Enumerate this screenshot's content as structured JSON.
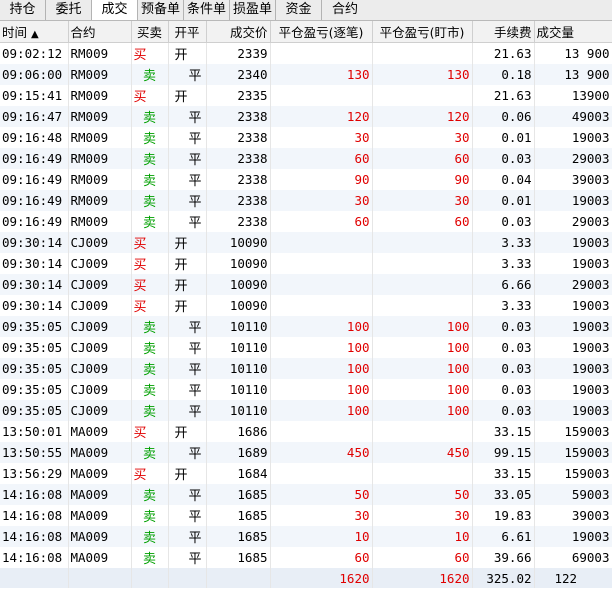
{
  "tabs": [
    {
      "label": "持仓",
      "active": false
    },
    {
      "label": "委托",
      "active": false
    },
    {
      "label": "成交",
      "active": true
    },
    {
      "label": "预备单",
      "active": false
    },
    {
      "label": "条件单",
      "active": false
    },
    {
      "label": "损盈单",
      "active": false
    },
    {
      "label": "资金",
      "active": false
    },
    {
      "label": "合约",
      "active": false
    }
  ],
  "columns": {
    "time": "时间",
    "sort_arrow": "▲",
    "code": "合约",
    "side": "买卖",
    "oc": "开平",
    "price": "成交价",
    "pnl_trade": "平仓盈亏(逐笔)",
    "pnl_mark": "平仓盈亏(盯市)",
    "fee": "手续费",
    "volume": "成交量"
  },
  "rows": [
    {
      "time": "09:02:12",
      "code": "RM009",
      "side": "买",
      "oc": "开",
      "price": "2339",
      "p1": "",
      "p2": "",
      "fee": "21.63",
      "vol": "13 900"
    },
    {
      "time": "09:06:00",
      "code": "RM009",
      "side": "卖",
      "oc": "平",
      "price": "2340",
      "p1": "130",
      "p2": "130",
      "fee": "0.18",
      "vol": "13 900"
    },
    {
      "time": "09:15:41",
      "code": "RM009",
      "side": "买",
      "oc": "开",
      "price": "2335",
      "p1": "",
      "p2": "",
      "fee": "21.63",
      "vol": "13900"
    },
    {
      "time": "09:16:47",
      "code": "RM009",
      "side": "卖",
      "oc": "平",
      "price": "2338",
      "p1": "120",
      "p2": "120",
      "fee": "0.06",
      "vol": "49003"
    },
    {
      "time": "09:16:48",
      "code": "RM009",
      "side": "卖",
      "oc": "平",
      "price": "2338",
      "p1": "30",
      "p2": "30",
      "fee": "0.01",
      "vol": "19003"
    },
    {
      "time": "09:16:49",
      "code": "RM009",
      "side": "卖",
      "oc": "平",
      "price": "2338",
      "p1": "60",
      "p2": "60",
      "fee": "0.03",
      "vol": "29003"
    },
    {
      "time": "09:16:49",
      "code": "RM009",
      "side": "卖",
      "oc": "平",
      "price": "2338",
      "p1": "90",
      "p2": "90",
      "fee": "0.04",
      "vol": "39003"
    },
    {
      "time": "09:16:49",
      "code": "RM009",
      "side": "卖",
      "oc": "平",
      "price": "2338",
      "p1": "30",
      "p2": "30",
      "fee": "0.01",
      "vol": "19003"
    },
    {
      "time": "09:16:49",
      "code": "RM009",
      "side": "卖",
      "oc": "平",
      "price": "2338",
      "p1": "60",
      "p2": "60",
      "fee": "0.03",
      "vol": "29003"
    },
    {
      "time": "09:30:14",
      "code": "CJ009",
      "side": "买",
      "oc": "开",
      "price": "10090",
      "p1": "",
      "p2": "",
      "fee": "3.33",
      "vol": "19003"
    },
    {
      "time": "09:30:14",
      "code": "CJ009",
      "side": "买",
      "oc": "开",
      "price": "10090",
      "p1": "",
      "p2": "",
      "fee": "3.33",
      "vol": "19003"
    },
    {
      "time": "09:30:14",
      "code": "CJ009",
      "side": "买",
      "oc": "开",
      "price": "10090",
      "p1": "",
      "p2": "",
      "fee": "6.66",
      "vol": "29003"
    },
    {
      "time": "09:30:14",
      "code": "CJ009",
      "side": "买",
      "oc": "开",
      "price": "10090",
      "p1": "",
      "p2": "",
      "fee": "3.33",
      "vol": "19003"
    },
    {
      "time": "09:35:05",
      "code": "CJ009",
      "side": "卖",
      "oc": "平",
      "price": "10110",
      "p1": "100",
      "p2": "100",
      "fee": "0.03",
      "vol": "19003"
    },
    {
      "time": "09:35:05",
      "code": "CJ009",
      "side": "卖",
      "oc": "平",
      "price": "10110",
      "p1": "100",
      "p2": "100",
      "fee": "0.03",
      "vol": "19003"
    },
    {
      "time": "09:35:05",
      "code": "CJ009",
      "side": "卖",
      "oc": "平",
      "price": "10110",
      "p1": "100",
      "p2": "100",
      "fee": "0.03",
      "vol": "19003"
    },
    {
      "time": "09:35:05",
      "code": "CJ009",
      "side": "卖",
      "oc": "平",
      "price": "10110",
      "p1": "100",
      "p2": "100",
      "fee": "0.03",
      "vol": "19003"
    },
    {
      "time": "09:35:05",
      "code": "CJ009",
      "side": "卖",
      "oc": "平",
      "price": "10110",
      "p1": "100",
      "p2": "100",
      "fee": "0.03",
      "vol": "19003"
    },
    {
      "time": "13:50:01",
      "code": "MA009",
      "side": "买",
      "oc": "开",
      "price": "1686",
      "p1": "",
      "p2": "",
      "fee": "33.15",
      "vol": "159003"
    },
    {
      "time": "13:50:55",
      "code": "MA009",
      "side": "卖",
      "oc": "平",
      "price": "1689",
      "p1": "450",
      "p2": "450",
      "fee": "99.15",
      "vol": "159003"
    },
    {
      "time": "13:56:29",
      "code": "MA009",
      "side": "买",
      "oc": "开",
      "price": "1684",
      "p1": "",
      "p2": "",
      "fee": "33.15",
      "vol": "159003"
    },
    {
      "time": "14:16:08",
      "code": "MA009",
      "side": "卖",
      "oc": "平",
      "price": "1685",
      "p1": "50",
      "p2": "50",
      "fee": "33.05",
      "vol": "59003"
    },
    {
      "time": "14:16:08",
      "code": "MA009",
      "side": "卖",
      "oc": "平",
      "price": "1685",
      "p1": "30",
      "p2": "30",
      "fee": "19.83",
      "vol": "39003"
    },
    {
      "time": "14:16:08",
      "code": "MA009",
      "side": "卖",
      "oc": "平",
      "price": "1685",
      "p1": "10",
      "p2": "10",
      "fee": "6.61",
      "vol": "19003"
    },
    {
      "time": "14:16:08",
      "code": "MA009",
      "side": "卖",
      "oc": "平",
      "price": "1685",
      "p1": "60",
      "p2": "60",
      "fee": "39.66",
      "vol": "69003"
    }
  ],
  "totals": {
    "p1": "1620",
    "p2": "1620",
    "fee": "325.02",
    "vol": "122"
  },
  "colors": {
    "buy": "#e00000",
    "sell": "#00a000",
    "profit": "#e00000",
    "stripe": "#f2f6fb"
  }
}
